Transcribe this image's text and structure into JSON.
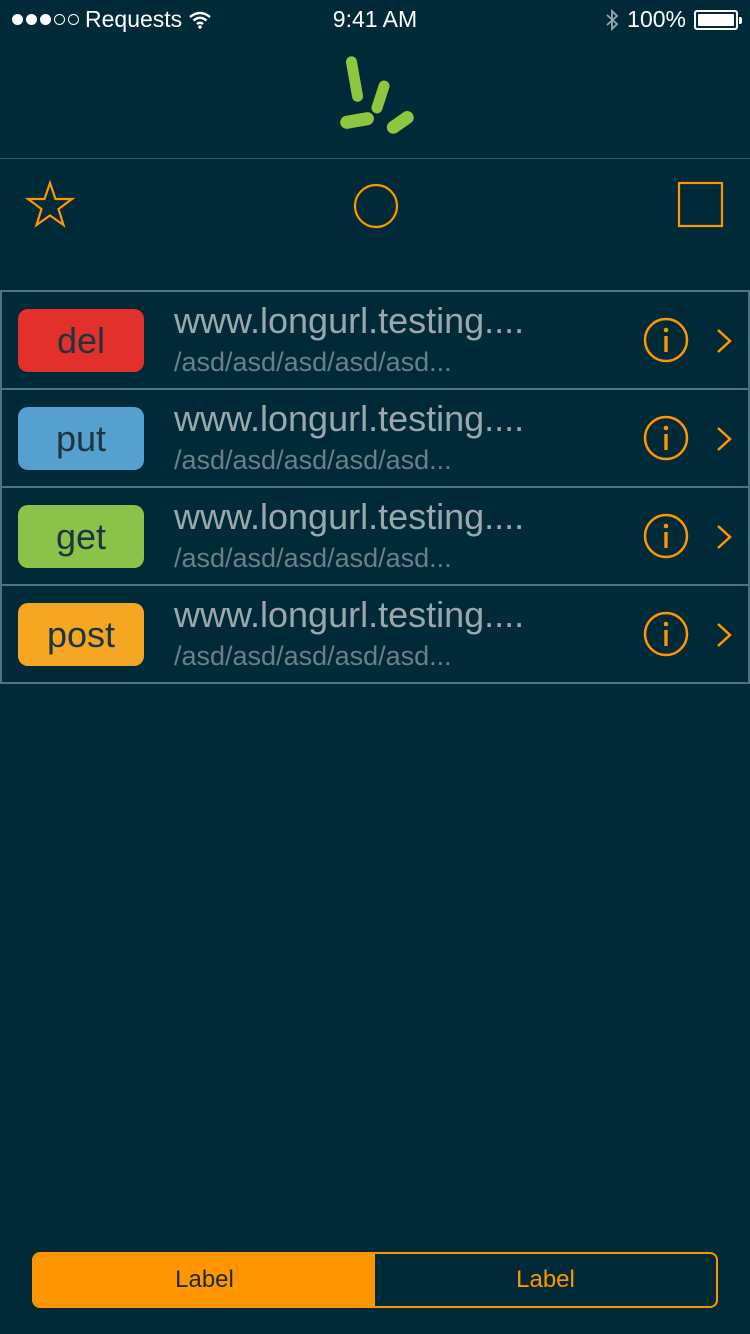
{
  "status_bar": {
    "carrier": "Requests",
    "time": "9:41 AM",
    "battery": "100%",
    "battery_level": 1.0,
    "signal_bars_filled": 3,
    "signal_bars_total": 5
  },
  "colors": {
    "background": "#002a38",
    "accent": "#ff9500",
    "logo": "#8dc63f",
    "divider": "#4f7480"
  },
  "toolbar": {
    "icons": [
      "star-icon",
      "circle-icon",
      "square-icon"
    ]
  },
  "requests": [
    {
      "method": "del",
      "color": "#e4302c",
      "url": "www.longurl.testing....",
      "path": "/asd/asd/asd/asd/asd..."
    },
    {
      "method": "put",
      "color": "#56a0cf",
      "url": "www.longurl.testing....",
      "path": "/asd/asd/asd/asd/asd..."
    },
    {
      "method": "get",
      "color": "#8bc34a",
      "url": "www.longurl.testing....",
      "path": "/asd/asd/asd/asd/asd..."
    },
    {
      "method": "post",
      "color": "#f5a623",
      "url": "www.longurl.testing....",
      "path": "/asd/asd/asd/asd/asd..."
    }
  ],
  "segmented_control": {
    "options": [
      "Label",
      "Label"
    ],
    "selected_index": 0
  }
}
